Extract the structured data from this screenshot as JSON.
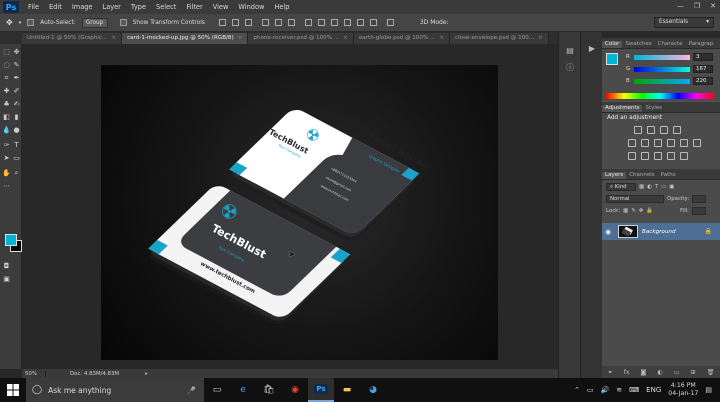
{
  "app": {
    "logo": "Ps"
  },
  "menubar": {
    "items": [
      "File",
      "Edit",
      "Image",
      "Layer",
      "Type",
      "Select",
      "Filter",
      "View",
      "Window",
      "Help"
    ],
    "controls": [
      "—",
      "❐",
      "✕"
    ]
  },
  "options": {
    "auto_select_label": "Auto-Select:",
    "auto_select_value": "Group",
    "transform_label": "Show Transform Controls",
    "workspace": "Essentials"
  },
  "tabs": [
    {
      "label": "Untitled-1 @ 50% (Graphic...",
      "active": false
    },
    {
      "label": "card-1-mocked-up.jpg @ 50% (RGB/8)",
      "active": true
    },
    {
      "label": "phone-receiver.psd @ 100% ...",
      "active": false
    },
    {
      "label": "earth-globe.psd @ 100% ...",
      "active": false
    },
    {
      "label": "close-envelope.psd @ 100...",
      "active": false
    }
  ],
  "status": {
    "zoom": "50%",
    "doc": "Doc: 4.83M/4.83M"
  },
  "color_panel": {
    "tabs": [
      "Color",
      "Swatches",
      "Characte",
      "Paragrap"
    ],
    "foreground": "#00b4d8",
    "background": "#000000",
    "sliders": [
      {
        "key": "R",
        "value": "3",
        "track": "linear-gradient(90deg,#00b4dc,#ffb4dc)"
      },
      {
        "key": "G",
        "value": "167",
        "track": "linear-gradient(90deg,#0300dc,#03ffdc)"
      },
      {
        "key": "B",
        "value": "220",
        "track": "linear-gradient(90deg,#03a700,#03a7ff)"
      }
    ]
  },
  "adjustments_panel": {
    "tabs": [
      "Adjustments",
      "Styles"
    ],
    "title": "Add an adjustment"
  },
  "layers_panel": {
    "tabs": [
      "Layers",
      "Channels",
      "Paths"
    ],
    "kind": "Kind",
    "blend_mode": "Normal",
    "opacity_label": "Opacity:",
    "lock_label": "Lock:",
    "fill_label": "Fill:",
    "layer_name": "Background"
  },
  "canvas": {
    "brand": "TechBlust",
    "tagline": "Your Company",
    "person_name": "Parvez Hossain",
    "person_title": "Graphic Designer",
    "website": "www.techblust.com",
    "phone": "+8801711223344",
    "email": "name@gmail.com",
    "address": "www.techblust.com",
    "accent": "#1aa3c9"
  },
  "taskbar": {
    "search_placeholder": "Ask me anything",
    "language": "ENG",
    "time": "4:16 PM",
    "date": "04-Jan-17"
  }
}
